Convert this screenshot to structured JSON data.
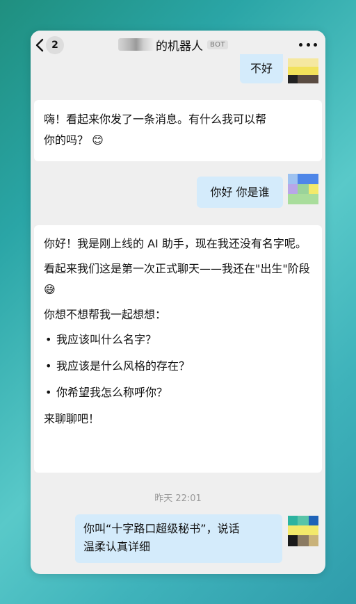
{
  "header": {
    "back_count": "2",
    "title": "的机器人",
    "bot_tag": "BOT"
  },
  "messages": [
    {
      "role": "user",
      "text": "不好"
    },
    {
      "role": "bot",
      "lines": [
        "嗨！看起来你发了一条消息。有什么我可以帮",
        "你的吗？ 😊"
      ]
    },
    {
      "role": "user",
      "text": "你好 你是谁"
    },
    {
      "role": "bot",
      "paragraphs": [
        "你好！我是刚上线的 AI 助手，现在我还没有名字呢。",
        "看起来我们这是第一次正式聊天——我还在\"出生\"阶段 😅",
        "你想不想帮我一起想想："
      ],
      "bullets": [
        "我应该叫什么名字？",
        "我应该是什么风格的存在？",
        "你希望我怎么称呼你？"
      ],
      "closing": "来聊聊吧！"
    },
    {
      "role": "user",
      "lines": [
        "你叫“十字路口超级秘书”，说话",
        "温柔认真详细"
      ]
    }
  ],
  "timestamp": "昨天 22:01"
}
